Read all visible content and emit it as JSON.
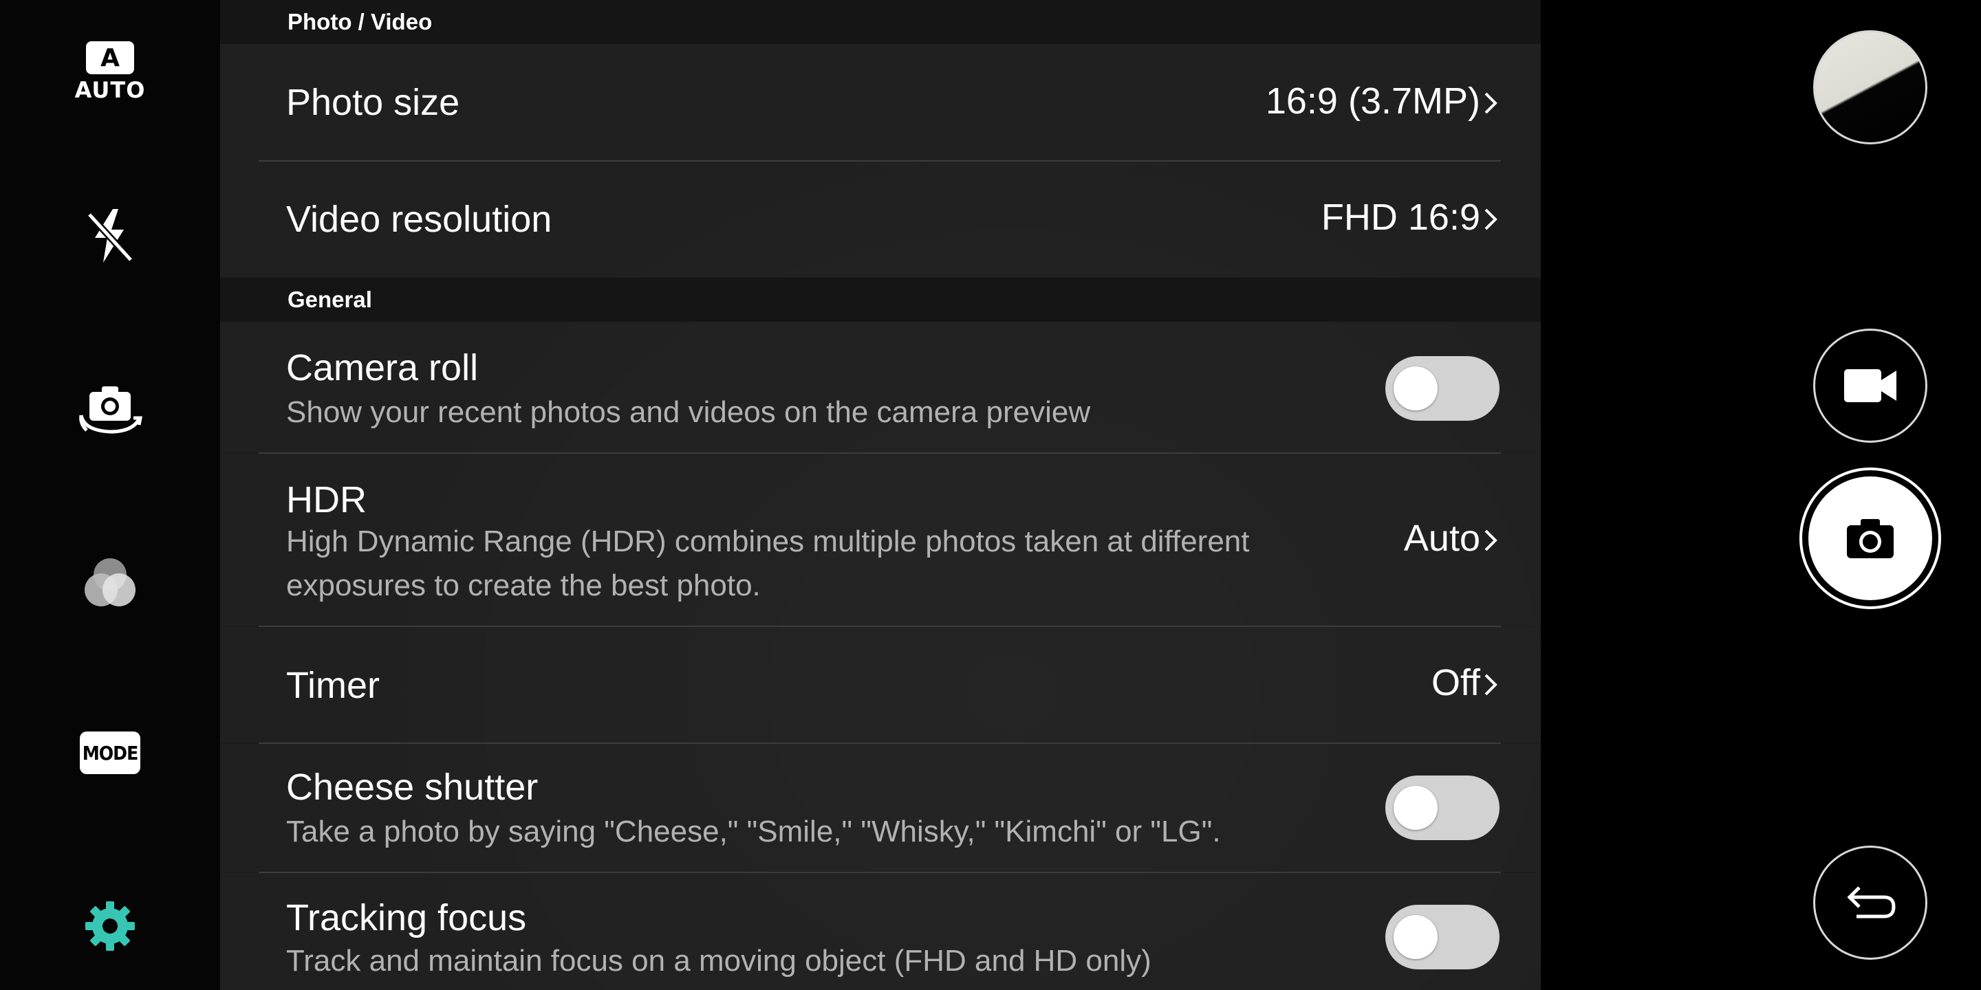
{
  "left_rail": {
    "auto_badge": "A",
    "auto_label": "AUTO",
    "mode_label": "MODE",
    "icons": [
      "auto-mode-icon",
      "flash-off-icon",
      "switch-camera-icon",
      "filter-icon",
      "mode-icon",
      "settings-gear-icon"
    ],
    "active_color": "#37c5b4"
  },
  "sections": {
    "photo_video": "Photo / Video",
    "general": "General"
  },
  "settings": {
    "photo_size": {
      "title": "Photo size",
      "value": "16:9 (3.7MP)"
    },
    "video_resolution": {
      "title": "Video resolution",
      "value": "FHD 16:9"
    },
    "camera_roll": {
      "title": "Camera roll",
      "desc": "Show your recent photos and videos on the camera preview",
      "enabled": false
    },
    "hdr": {
      "title": "HDR",
      "desc": "High Dynamic Range (HDR) combines multiple photos taken at different exposures to create the best photo.",
      "value": "Auto"
    },
    "timer": {
      "title": "Timer",
      "value": "Off"
    },
    "cheese_shutter": {
      "title": "Cheese shutter",
      "desc": "Take a photo by saying \"Cheese,\" \"Smile,\" \"Whisky,\" \"Kimchi\" or \"LG\".",
      "enabled": false
    },
    "tracking_focus": {
      "title": "Tracking focus",
      "desc": "Track and maintain focus on a moving object (FHD and HD only)",
      "enabled": false
    }
  },
  "right_rail": {
    "icons": [
      "gallery-thumbnail",
      "video-record-icon",
      "camera-shutter-icon",
      "back-icon"
    ]
  }
}
